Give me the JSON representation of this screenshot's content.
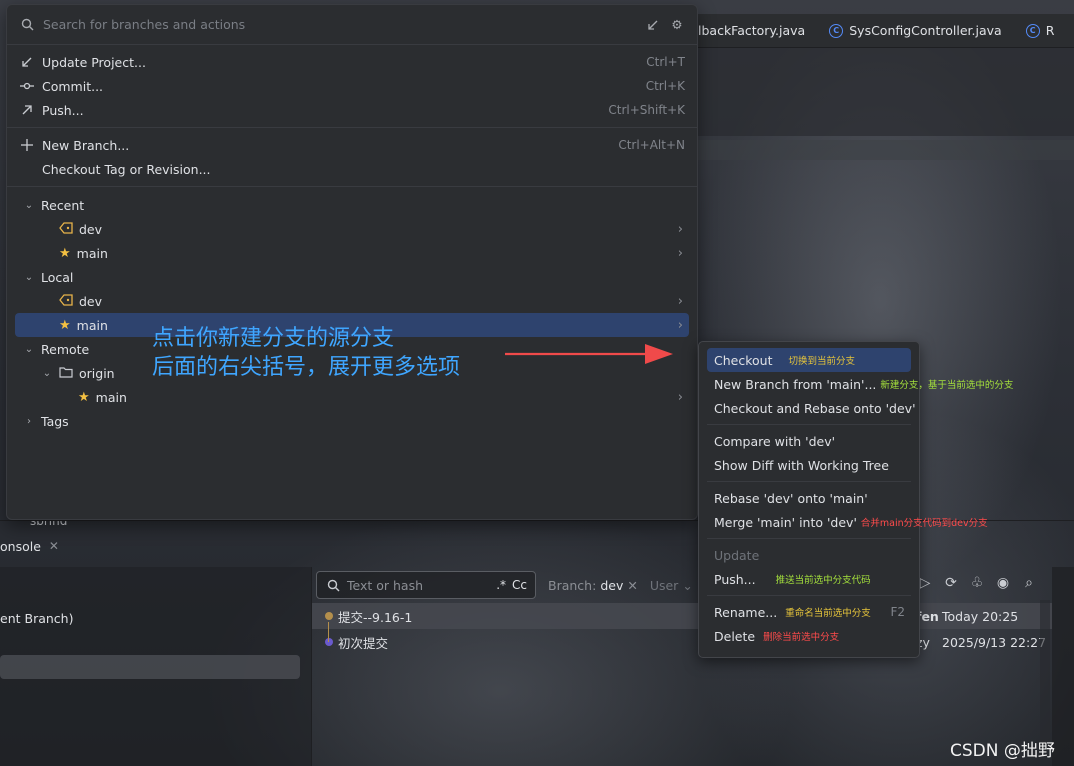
{
  "editor_tabs": [
    {
      "label": "lbackFactory.java"
    },
    {
      "label": "SysConfigController.java"
    },
    {
      "label": "R"
    }
  ],
  "bottom": {
    "under_panel_label": "sbrind",
    "console_tab": "onsole",
    "left_row": "ent Branch)",
    "filter_placeholder": "Text or hash",
    "regex_opt": ".*",
    "case_opt": "Cc",
    "branch_label": "Branch:",
    "branch_value": "dev",
    "user_label": "User",
    "commits": [
      {
        "message": "提交--9.16-1",
        "author": "fen",
        "date": "Today 20:25"
      },
      {
        "message": "初次提交",
        "author": "zy",
        "date": "2025/9/13 22:27"
      }
    ]
  },
  "popup": {
    "search_placeholder": "Search for branches and actions",
    "actions": [
      {
        "label": "Update Project...",
        "shortcut": "Ctrl+T",
        "icon": "update-arrow-icon"
      },
      {
        "label": "Commit...",
        "shortcut": "Ctrl+K",
        "icon": "commit-icon"
      },
      {
        "label": "Push...",
        "shortcut": "Ctrl+Shift+K",
        "icon": "push-arrow-icon"
      }
    ],
    "branch_actions": [
      {
        "label": "New Branch...",
        "shortcut": "Ctrl+Alt+N",
        "icon": "plus-icon"
      },
      {
        "label": "Checkout Tag or Revision...",
        "shortcut": ""
      }
    ],
    "groups": {
      "recent": "Recent",
      "recent_items": [
        "dev",
        "main"
      ],
      "local": "Local",
      "local_items": [
        "dev",
        "main"
      ],
      "remote": "Remote",
      "origin": "origin",
      "remote_items": [
        "main"
      ],
      "tags": "Tags"
    }
  },
  "annotation": {
    "line1": "点击你新建分支的源分支",
    "line2": "后面的右尖括号，展开更多选项"
  },
  "submenu": {
    "checkout": "Checkout",
    "checkout_note": "切换到当前分支",
    "new_branch": "New Branch from 'main'...",
    "new_branch_note": "新建分支，基于当前选中的分支",
    "checkout_rebase": "Checkout and Rebase onto 'dev'",
    "compare": "Compare with 'dev'",
    "show_diff": "Show Diff with Working Tree",
    "rebase": "Rebase 'dev' onto 'main'",
    "merge": "Merge 'main' into 'dev'",
    "merge_note": "合并main分支代码到dev分支",
    "update": "Update",
    "push": "Push...",
    "push_note": "推送当前选中分支代码",
    "rename": "Rename...",
    "rename_note": "重命名当前选中分支",
    "rename_kbd": "F2",
    "delete": "Delete",
    "delete_note": "删除当前选中分支"
  },
  "watermark": "CSDN @拙野",
  "colors": {
    "selection": "#2e436e",
    "annotation_blue": "#3fa6ff",
    "arrow_red": "#f04a4a",
    "note_yellow": "#e5c43b",
    "note_green": "#a4e03c",
    "note_red": "#ff4b4b"
  }
}
